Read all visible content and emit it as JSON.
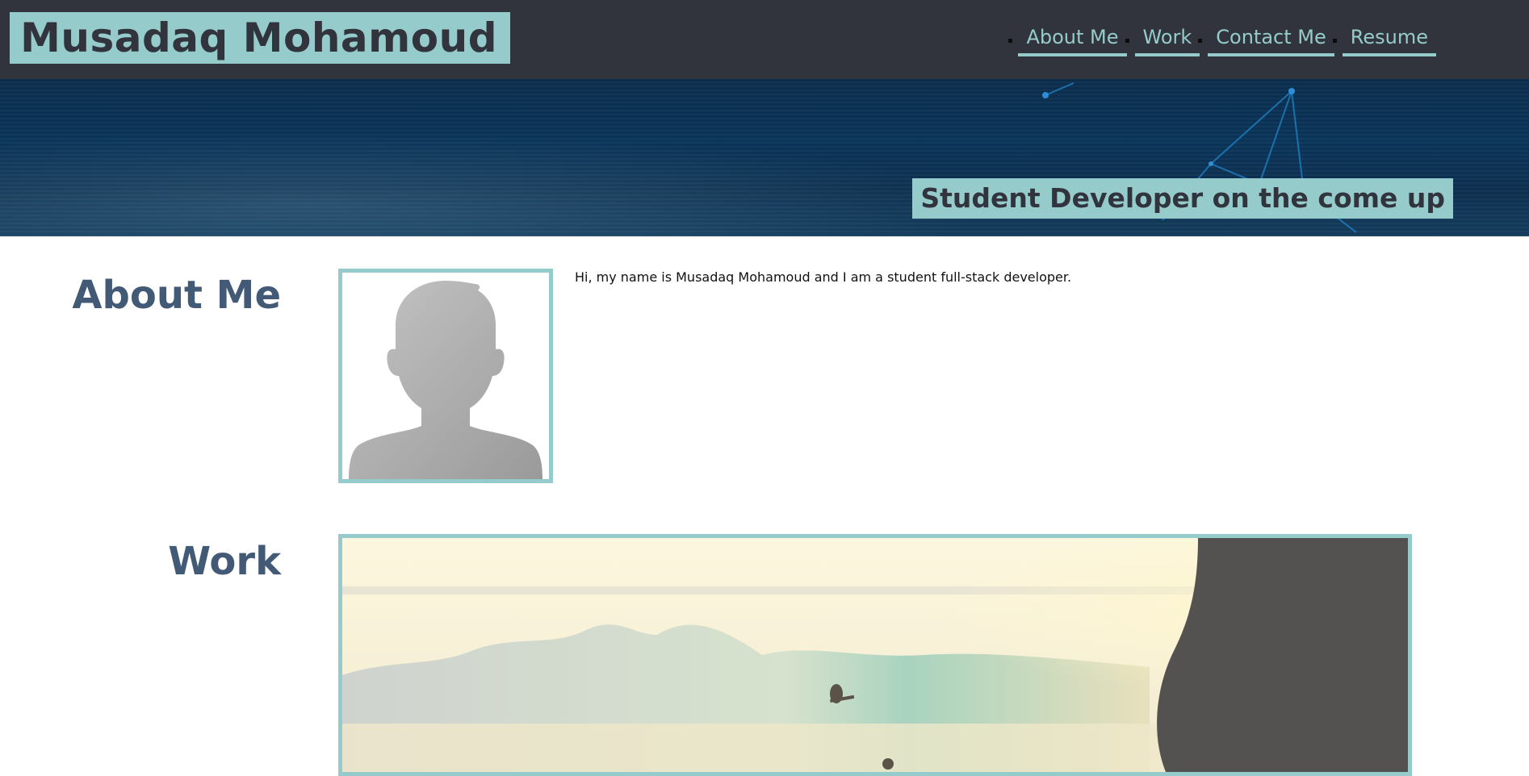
{
  "header": {
    "site_title": "Musadaq Mohamoud",
    "nav": [
      {
        "label": "About Me"
      },
      {
        "label": "Work"
      },
      {
        "label": "Contact Me"
      },
      {
        "label": "Resume"
      }
    ]
  },
  "hero": {
    "tagline": "Student Developer on the come up"
  },
  "about": {
    "heading": "About Me",
    "text": "Hi, my name is Musadaq Mohamoud and I am a student full-stack developer.",
    "image_icon": "person-silhouette"
  },
  "work": {
    "heading": "Work",
    "image_icon": "surfer-photo"
  },
  "colors": {
    "header_bg": "#31343c",
    "accent": "#96cbcb",
    "heading": "#435a76",
    "hero_bg": "#0a3458"
  }
}
